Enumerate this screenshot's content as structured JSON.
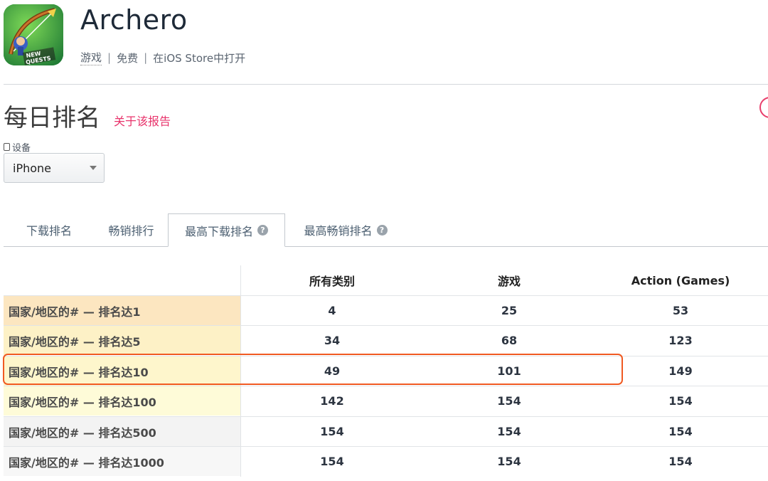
{
  "app": {
    "title": "Archero",
    "category": "游戏",
    "price": "免费",
    "store_link": "在iOS Store中打开",
    "separator": "|",
    "icon_badge_line1": "NEW",
    "icon_badge_line2": "QUESTS"
  },
  "section": {
    "title": "每日排名",
    "about_link": "关于该报告"
  },
  "device": {
    "label": "设备",
    "selected": "iPhone"
  },
  "tabs": [
    {
      "label": "下载排名",
      "active": false
    },
    {
      "label": "畅销排行",
      "active": false
    },
    {
      "label": "最高下载排名",
      "active": true
    },
    {
      "label": "最高畅销排名",
      "active": false
    }
  ],
  "table": {
    "columns": [
      "所有类别",
      "游戏",
      "Action (Games)"
    ],
    "rows": [
      {
        "label": "国家/地区的# — 排名达1",
        "values": [
          "4",
          "25",
          "53"
        ],
        "bg": "#fce6c0"
      },
      {
        "label": "国家/地区的# — 排名达5",
        "values": [
          "34",
          "68",
          "123"
        ],
        "bg": "#fdf1c6"
      },
      {
        "label": "国家/地区的# — 排名达10",
        "values": [
          "49",
          "101",
          "149"
        ],
        "bg": "#fef6cc"
      },
      {
        "label": "国家/地区的# — 排名达100",
        "values": [
          "142",
          "154",
          "154"
        ],
        "bg": "#fefbd8"
      },
      {
        "label": "国家/地区的# — 排名达500",
        "values": [
          "154",
          "154",
          "154"
        ],
        "bg": "#f3f3f3"
      },
      {
        "label": "国家/地区的# — 排名达1000",
        "values": [
          "154",
          "154",
          "154"
        ],
        "bg": "#f7f7f7"
      }
    ]
  },
  "colors": {
    "accent": "#e8336b",
    "highlight": "#f05a22"
  }
}
